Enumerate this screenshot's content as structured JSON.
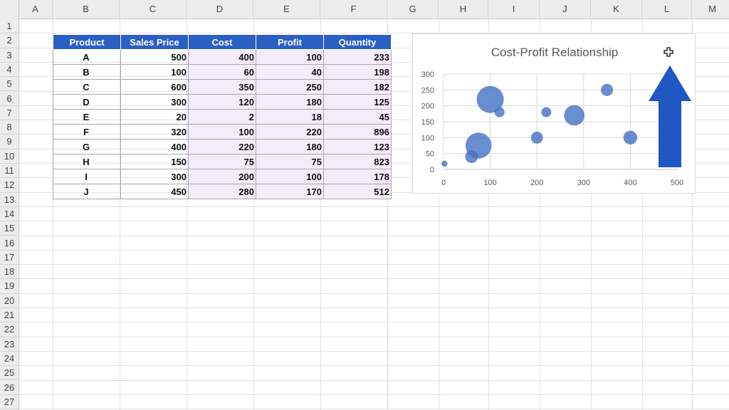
{
  "sheet": {
    "columns": [
      "A",
      "B",
      "C",
      "D",
      "E",
      "F",
      "G",
      "H",
      "I",
      "J",
      "K",
      "L",
      "M"
    ],
    "rows": [
      "1",
      "2",
      "3",
      "4",
      "5",
      "6",
      "7",
      "8",
      "9",
      "10",
      "11",
      "12",
      "13",
      "14",
      "15",
      "16",
      "17",
      "18",
      "19",
      "20",
      "21",
      "22",
      "23",
      "24",
      "25",
      "26",
      "27"
    ]
  },
  "table": {
    "headers": [
      "Product",
      "Sales Price",
      "Cost",
      "Profit",
      "Quantity"
    ],
    "rows": [
      [
        "A",
        "500",
        "400",
        "100",
        "233"
      ],
      [
        "B",
        "100",
        "60",
        "40",
        "198"
      ],
      [
        "C",
        "600",
        "350",
        "250",
        "182"
      ],
      [
        "D",
        "300",
        "120",
        "180",
        "125"
      ],
      [
        "E",
        "20",
        "2",
        "18",
        "45"
      ],
      [
        "F",
        "320",
        "100",
        "220",
        "896"
      ],
      [
        "G",
        "400",
        "220",
        "180",
        "123"
      ],
      [
        "H",
        "150",
        "75",
        "75",
        "823"
      ],
      [
        "I",
        "300",
        "200",
        "100",
        "178"
      ],
      [
        "J",
        "450",
        "280",
        "170",
        "512"
      ]
    ]
  },
  "chart_data": {
    "type": "scatter",
    "subtype": "bubble",
    "title": "Cost-Profit Relationship",
    "xlabel": "",
    "ylabel": "",
    "xlim": [
      0,
      500
    ],
    "ylim": [
      0,
      300
    ],
    "x_ticks": [
      "0",
      "100",
      "200",
      "300",
      "400",
      "500"
    ],
    "y_ticks": [
      "0",
      "50",
      "100",
      "150",
      "200",
      "250",
      "300"
    ],
    "grid": true,
    "legend": "none",
    "series": [
      {
        "points": [
          {
            "x": 400,
            "y": 100,
            "size": 233
          },
          {
            "x": 60,
            "y": 40,
            "size": 198
          },
          {
            "x": 350,
            "y": 250,
            "size": 182
          },
          {
            "x": 120,
            "y": 180,
            "size": 125
          },
          {
            "x": 2,
            "y": 18,
            "size": 45
          },
          {
            "x": 100,
            "y": 220,
            "size": 896
          },
          {
            "x": 220,
            "y": 180,
            "size": 123
          },
          {
            "x": 75,
            "y": 75,
            "size": 823
          },
          {
            "x": 200,
            "y": 100,
            "size": 178
          },
          {
            "x": 280,
            "y": 170,
            "size": 512
          }
        ]
      }
    ]
  },
  "colors": {
    "header_fill": "#2a5fc4",
    "selection_fill": "#f4ecf9",
    "bubble": "#4472c4",
    "arrow": "#1f57c3"
  },
  "icons": [
    "up-arrow-shape-icon",
    "move-cursor-icon"
  ]
}
